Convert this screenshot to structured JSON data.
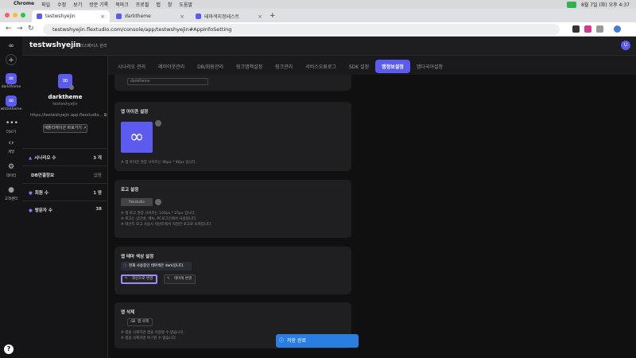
{
  "mac_menu": {
    "apple": "",
    "items": [
      "Chrome",
      "파일",
      "수정",
      "보기",
      "방문 기록",
      "북마크",
      "프로필",
      "탭",
      "창",
      "도움말"
    ],
    "clock": "8월 7일 (화) 오후 4:37"
  },
  "browser": {
    "tabs": [
      {
        "label": "testwshyejin",
        "active": true
      },
      {
        "label": "darktheme",
        "active": false
      },
      {
        "label": "테마색지정테스트",
        "active": false
      }
    ],
    "new_tab": "+",
    "url": "testwshyejin.flextudio.com/console/app/testwshyejin#AppInfoSetting"
  },
  "rail": {
    "items": [
      {
        "label": "darktheme",
        "glyph": "∞",
        "active": true
      },
      {
        "label": "whitetheme",
        "glyph": "∞",
        "active": false
      },
      {
        "label": "더보기",
        "glyph": "•••",
        "active": false
      },
      {
        "label": "개발",
        "glyph": "‹›",
        "active": false
      },
      {
        "label": "데이터",
        "glyph": "⚙",
        "active": false
      },
      {
        "label": "고객센터",
        "glyph": "●",
        "active": false
      }
    ],
    "help": "?"
  },
  "header": {
    "project": "testwshyejin",
    "workspace": "⚙ 워크스페이스 관리",
    "avatar": "U"
  },
  "nav_tabs": [
    "시나리오 관리",
    "레이아웃관리",
    "DB/회원관리",
    "링크앱맥설정",
    "링크관리",
    "서비스오류로그",
    "SDK 설정",
    "앱정보설정",
    "앱다국어설정"
  ],
  "active_tab": "앱정보설정",
  "left_panel": {
    "app_name": "darktheme",
    "app_id": "testwshyejin",
    "app_url": "https://testwshyejin.app.flexstudio...",
    "goto_button": "애플리케이션 바로가기 ↗",
    "stats": [
      {
        "icon": "▲",
        "label": "시나리오 수",
        "value": "3 개"
      },
      {
        "icon": "",
        "label": "DB연결정보",
        "value": "없음"
      },
      {
        "icon": "●",
        "label": "회원 수",
        "value": "1 명"
      },
      {
        "icon": "●",
        "label": "방문자 수",
        "value": "38"
      }
    ]
  },
  "top_input_value": "darktheme",
  "icon_card": {
    "title": "앱 아이콘 설정",
    "glyph": "∞",
    "note": "※ 앱 아이콘 권장 사이즈는 96px * 96px 입니다."
  },
  "logo_card": {
    "title": "로고 설정",
    "logo_placeholder": "flexstudio",
    "notes": [
      "※ 앱 로고 권장 사이즈는 100px * 25px 입니다.",
      "※ 로고는 상단바, 메뉴, PC로그인에서 사용됩니다.",
      "※ 테넌트 로고 사용시 테넌트에서 지정한 로고로 보여집니다."
    ]
  },
  "theme_card": {
    "title": "앱 테마 색상 설정",
    "info": "현재 사용중인 테마색은 dark입니다.",
    "apply_button": "최신으로 변경",
    "change_button": "테마색 변경"
  },
  "delete_card": {
    "title": "앱 삭제",
    "button": "앱 삭제",
    "notes": [
      "※ 앱을 삭제하면 앱을 이용할 수 없습니다.",
      "※ 앱을 삭제하면 복구할 수 없습니다."
    ]
  },
  "toast": "저장 완료"
}
